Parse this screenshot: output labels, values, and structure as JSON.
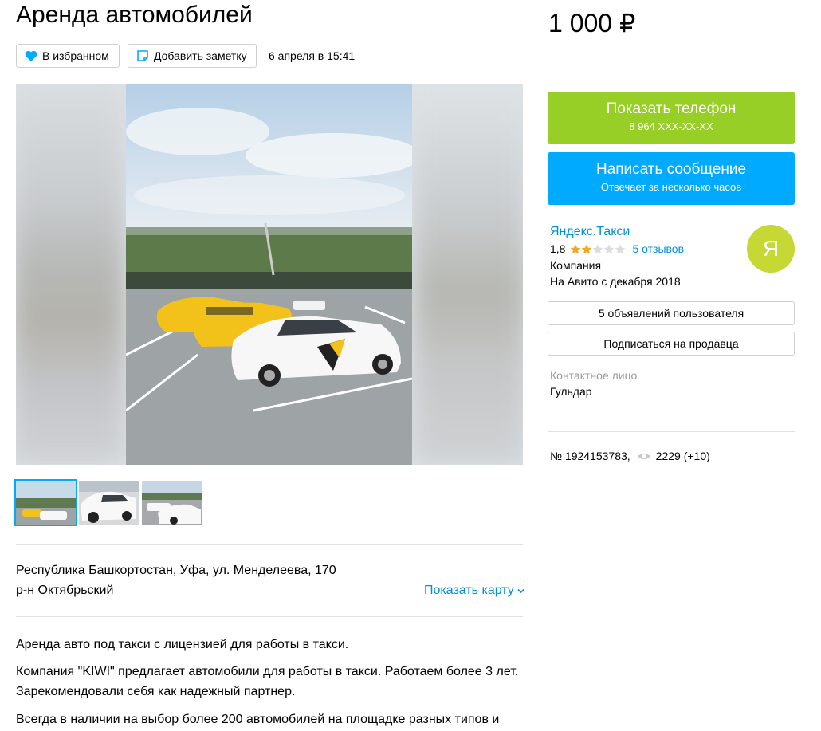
{
  "listing": {
    "title": "Аренда автомобилей",
    "price": "1 000 ₽",
    "favorite_label": "В избранном",
    "note_label": "Добавить заметку",
    "date": "6 апреля в 15:41"
  },
  "gallery": {
    "thumbnails": [
      "thumb-1",
      "thumb-2",
      "thumb-3"
    ],
    "active_index": 0
  },
  "location": {
    "address": "Республика Башкортостан, Уфа, ул. Менделеева, 170",
    "district": "р-н Октябрьский",
    "show_map": "Показать карту"
  },
  "description": [
    "Аренда авто под такси с лицензией для работы в такси.",
    "Компания \"KIWI\" предлагает автомобили для работы в такси. Работаем более 3 лет.",
    "Зарекомендовали себя как надежный партнер.",
    "Всегда в наличии на выбор более 200 автомобилей на площадке разных типов и"
  ],
  "contact": {
    "phone_button": "Показать телефон",
    "phone_masked": "8 964 XXX-XX-XX",
    "message_button": "Написать сообщение",
    "message_sub": "Отвечает за несколько часов"
  },
  "seller": {
    "name": "Яндекс.Такси",
    "rating": "1,8",
    "stars_filled": 2,
    "stars_total": 5,
    "reviews": "5 отзывов",
    "type": "Компания",
    "since": "На Авито с декабря 2018",
    "avatar_letter": "Я",
    "ads_button": "5 объявлений пользователя",
    "subscribe_button": "Подписаться на продавца",
    "contact_label": "Контактное лицо",
    "contact_name": "Гульдар"
  },
  "meta": {
    "number": "№ 1924153783,",
    "views": "2229 (+10)"
  },
  "colors": {
    "green": "#97cf26",
    "blue": "#00aaff",
    "link": "#0091d9",
    "avatar": "#c5d834",
    "star": "#f5a623"
  }
}
